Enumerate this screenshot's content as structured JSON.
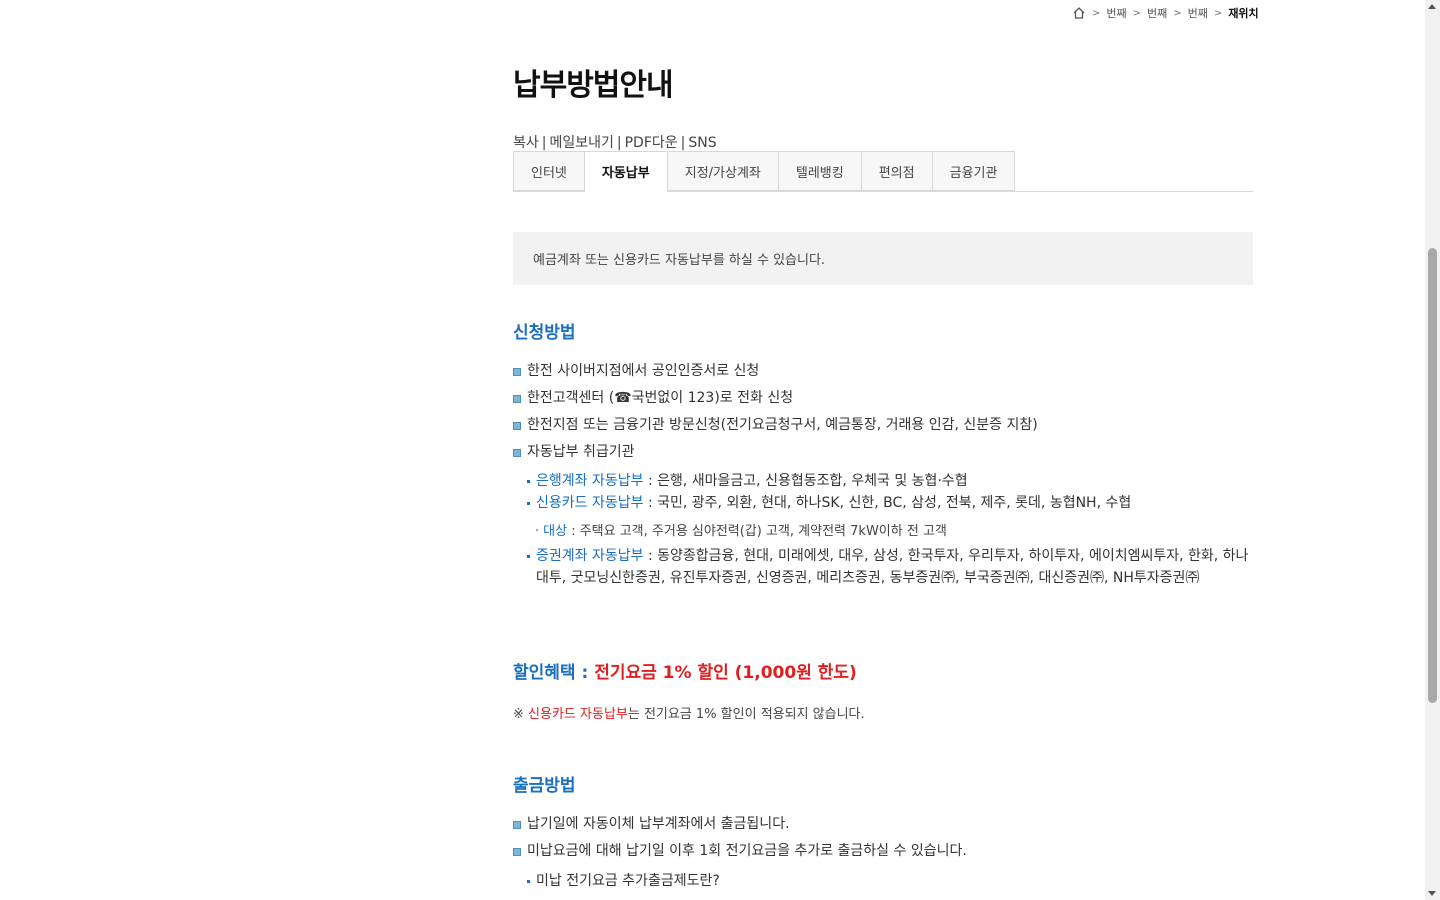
{
  "breadcrumb": {
    "home_icon": "home-icon",
    "items": [
      "번째",
      "번째",
      "번째"
    ],
    "current": "재위치"
  },
  "page": {
    "title": "납부방법안내"
  },
  "share": {
    "copy": "복사",
    "mail": "메일보내기",
    "pdf": "PDF다운",
    "sns": "SNS",
    "separator": "|"
  },
  "tabs": [
    {
      "label": "인터넷",
      "active": false
    },
    {
      "label": "자동납부",
      "active": true
    },
    {
      "label": "지정/가상계좌",
      "active": false
    },
    {
      "label": "텔레뱅킹",
      "active": false
    },
    {
      "label": "편의점",
      "active": false
    },
    {
      "label": "금융기관",
      "active": false
    }
  ],
  "notice": "예금계좌 또는 신용카드 자동납부를 하실 수 있습니다.",
  "apply": {
    "title": "신청방법",
    "items": [
      "한전 사이버지점에서 공인인증서로 신청",
      "한전고객센터 (☎국번없이 123)로 전화 신청",
      "한전지점 또는 금융기관 방문신청(전기요금청구서, 예금통장, 거래용 인감, 신분증 지참)",
      "자동납부 취급기관"
    ],
    "institutions": [
      {
        "label": "은행계좌 자동납부",
        "text": " : 은행, 새마을금고, 신용협동조합, 우체국 및 농협·수협"
      },
      {
        "label": "신용카드 자동납부",
        "text": " : 국민, 광주, 외환, 현대, 하나SK, 신한, BC, 삼성, 전북, 제주, 롯데, 농협NH, 수협"
      },
      {
        "label": "증권계좌 자동납부",
        "text": " : 동양종합금융, 현대, 미래에셋, 대우, 삼성, 한국투자, 우리투자, 하이투자, 에이치엠씨투자, 한화, 하나대투, 굿모닝신한증권, 유진투자증권, 신영증권, 메리츠증권, 동부증권㈜, 부국증권㈜, 대신증권㈜, NH투자증권㈜"
      }
    ],
    "target": {
      "label": "대상",
      "text": " : 주택요 고객, 주거용 심야전력(갑) 고객, 계약전력 7kW이하 전 고객"
    }
  },
  "discount": {
    "label": "할인혜택 :",
    "value": "전기요금 1% 할인 (1,000원 한도)"
  },
  "note": {
    "prefix": "※",
    "highlight": "신용카드 자동납부",
    "text": "는 전기요금 1% 할인이 적용되지 않습니다."
  },
  "withdraw": {
    "title": "출금방법",
    "items": [
      "납기일에 자동이체 납부계좌에서 출금됩니다.",
      "미납요금에 대해 납기일 이후 1회 전기요금을 추가로 출금하실 수 있습니다."
    ],
    "sub_item": "미납 전기요금 추가출금제도란?"
  },
  "colors": {
    "accent_blue": "#1a6fc0",
    "accent_red": "#e02020",
    "notice_bg": "#f2f2f2"
  }
}
